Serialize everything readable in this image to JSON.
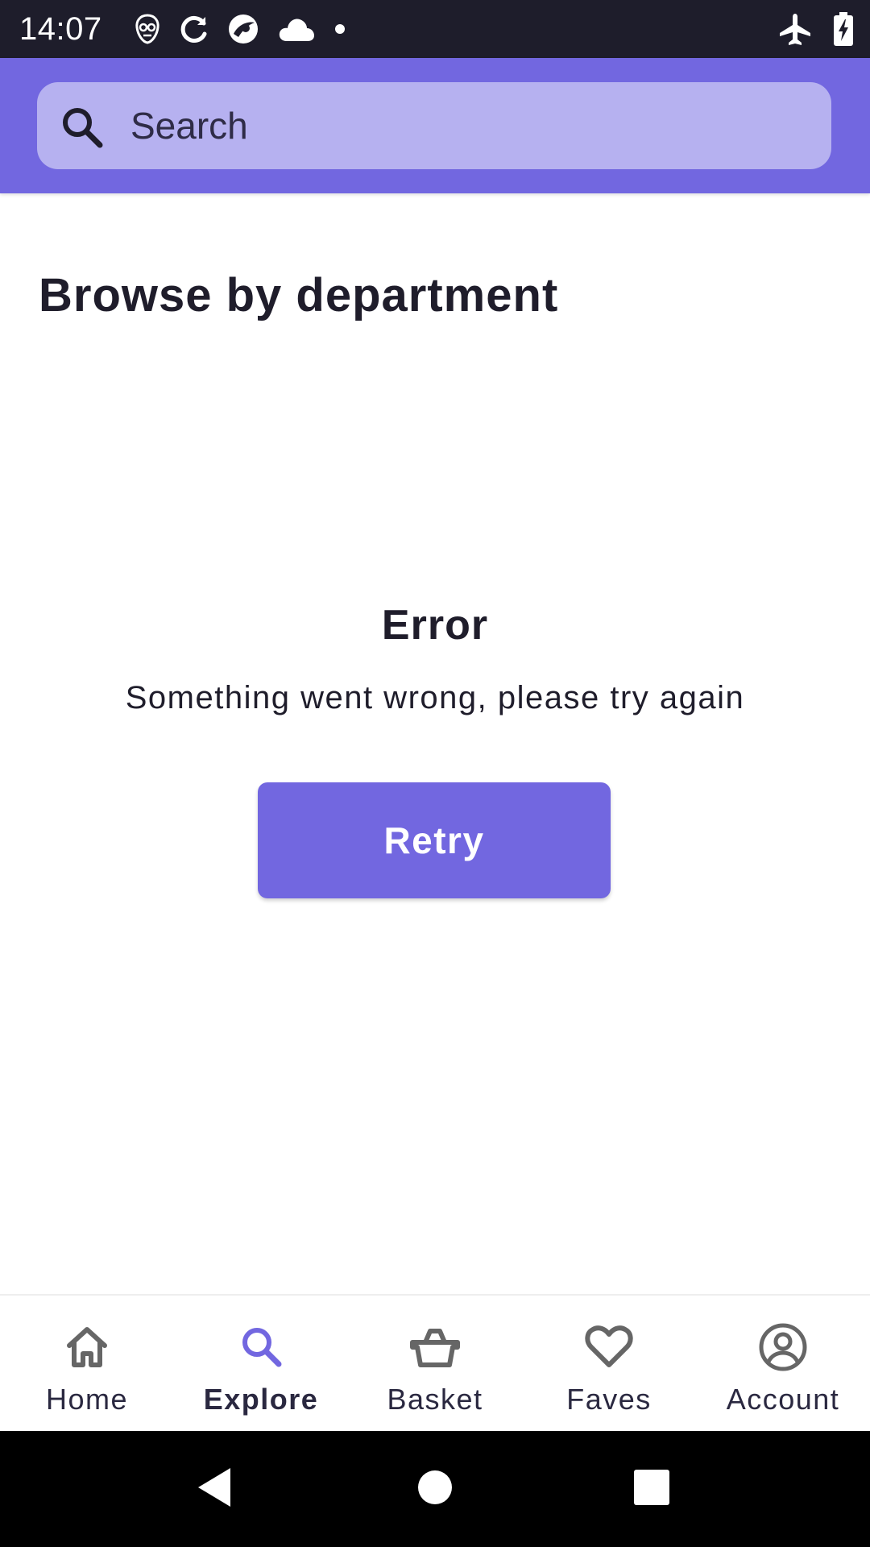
{
  "status_bar": {
    "time": "14:07",
    "left_icons": [
      "alien-face-icon",
      "sync-icon",
      "app-circle-icon",
      "cloud-icon",
      "dot-icon"
    ],
    "right_icons": [
      "airplane-icon",
      "battery-charging-icon"
    ]
  },
  "search": {
    "placeholder": "Search",
    "value": ""
  },
  "content": {
    "title": "Browse by department",
    "error_title": "Error",
    "error_message": "Something went wrong, please try again",
    "retry_label": "Retry"
  },
  "bottom_nav": {
    "items": [
      {
        "label": "Home",
        "icon": "home-icon",
        "active": false
      },
      {
        "label": "Explore",
        "icon": "search-icon",
        "active": true
      },
      {
        "label": "Basket",
        "icon": "basket-icon",
        "active": false
      },
      {
        "label": "Faves",
        "icon": "heart-icon",
        "active": false
      },
      {
        "label": "Account",
        "icon": "account-icon",
        "active": false
      }
    ]
  },
  "colors": {
    "brand": "#7267e0",
    "search_field": "#b6b1f0",
    "text": "#1f1d2b",
    "nav_icon": "#6b6b6b",
    "status_bar": "#1e1d2b"
  }
}
